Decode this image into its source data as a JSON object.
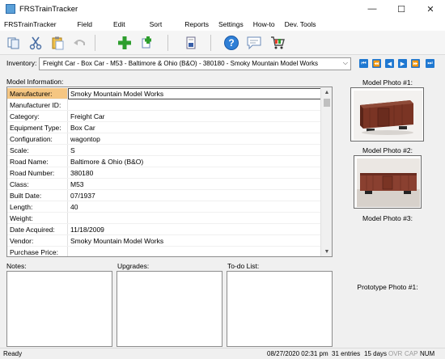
{
  "window": {
    "title": "FRSTrainTracker",
    "minimize_glyph": "—",
    "maximize_glyph": "☐",
    "close_glyph": "✕"
  },
  "menu": [
    "FRSTrainTracker",
    "Field",
    "Edit",
    "Sort",
    "Reports",
    "Settings",
    "How-to",
    "Dev. Tools"
  ],
  "toolbar_icons": [
    "copy-icon",
    "cut-icon",
    "paste-icon",
    "undo-icon",
    "add-icon",
    "duplicate-icon",
    "report-icon",
    "help-icon",
    "comment-icon",
    "cart-icon"
  ],
  "inventory": {
    "label": "Inventory:",
    "selected": "Freight Car - Box Car - M53 - Baltimore & Ohio (B&O) - 380180 - Smoky Mountain Model Works",
    "nav_icons": [
      "first-record-icon",
      "previous-page-icon",
      "previous-record-icon",
      "next-record-icon",
      "next-page-icon",
      "last-record-icon"
    ]
  },
  "model_info": {
    "label": "Model Information:",
    "rows": [
      {
        "label": "Manufacturer:",
        "value": "Smoky Mountain Model Works"
      },
      {
        "label": "Manufacturer ID:",
        "value": ""
      },
      {
        "label": "Category:",
        "value": "Freight Car"
      },
      {
        "label": "Equipment Type:",
        "value": "Box Car"
      },
      {
        "label": "Configuration:",
        "value": "wagontop"
      },
      {
        "label": "Scale:",
        "value": "S"
      },
      {
        "label": "Road Name:",
        "value": "Baltimore & Ohio (B&O)"
      },
      {
        "label": "Road Number:",
        "value": "380180"
      },
      {
        "label": "Class:",
        "value": "M53"
      },
      {
        "label": "Built Date:",
        "value": "07/1937"
      },
      {
        "label": "Length:",
        "value": "40"
      },
      {
        "label": "Weight:",
        "value": ""
      },
      {
        "label": "Date Acquired:",
        "value": "11/18/2009"
      },
      {
        "label": "Vendor:",
        "value": "Smoky Mountain Model Works"
      },
      {
        "label": "Purchase Price:",
        "value": ""
      }
    ]
  },
  "photos": {
    "photo1_label": "Model Photo #1:",
    "photo2_label": "Model Photo #2:",
    "photo3_label": "Model Photo #3:",
    "prototype_label": "Prototype Photo #1:"
  },
  "notes": {
    "notes_label": "Notes:",
    "upgrades_label": "Upgrades:",
    "todo_label": "To-do List:"
  },
  "status": {
    "state": "Ready",
    "datetime": "08/27/2020 02:31 pm",
    "entries": "31 entries",
    "days": "15 days",
    "ovr": "OVR",
    "cap": "CAP",
    "num": "NUM"
  }
}
